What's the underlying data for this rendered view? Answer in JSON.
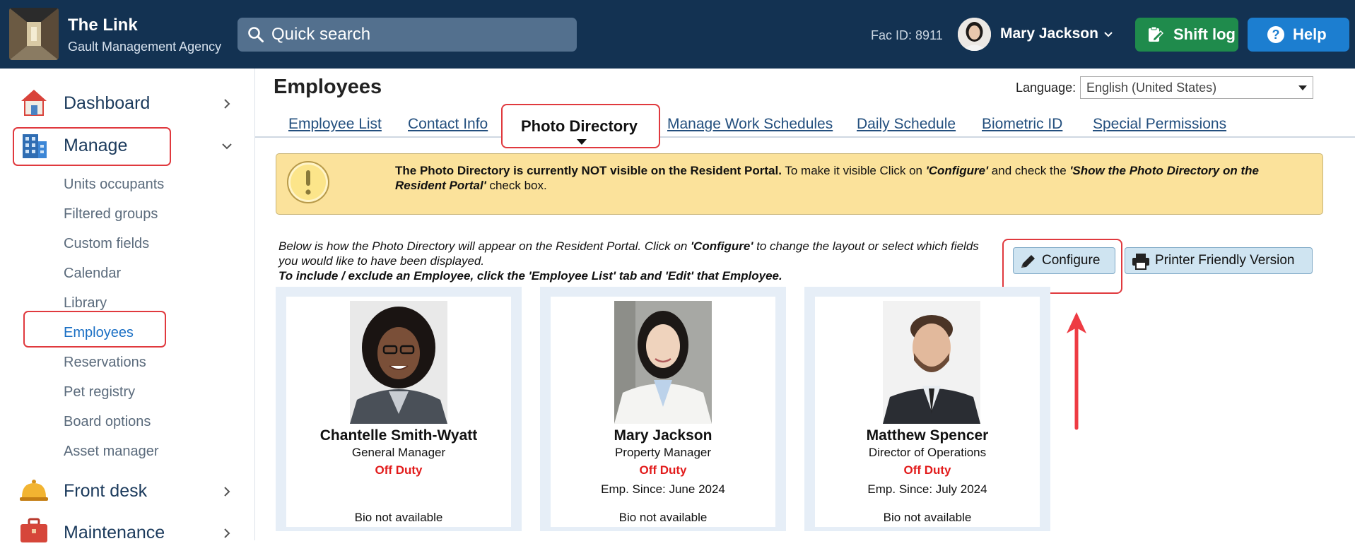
{
  "header": {
    "brand_name": "The Link",
    "brand_sub": "Gault Management Agency",
    "search_placeholder": "Quick search",
    "fac_id": "Fac ID: 8911",
    "user_name": "Mary Jackson",
    "shift_log": "Shift log",
    "help": "Help"
  },
  "sidebar": {
    "dashboard": "Dashboard",
    "manage": "Manage",
    "manage_items": [
      "Units occupants",
      "Filtered groups",
      "Custom fields",
      "Calendar",
      "Library",
      "Employees",
      "Reservations",
      "Pet registry",
      "Board options",
      "Asset manager"
    ],
    "front_desk": "Front desk",
    "maintenance": "Maintenance"
  },
  "main": {
    "title": "Employees",
    "language_label": "Language:",
    "language_value": "English (United States)",
    "tabs": [
      "Employee List",
      "Contact Info",
      "Photo Directory",
      "Manage Work Schedules",
      "Daily Schedule",
      "Biometric ID",
      "Special Permissions"
    ],
    "alert_bold": "The Photo Directory is currently NOT visible on the Resident Portal.",
    "alert_text1": " To make it visible Click on ",
    "alert_bi1": "'Configure'",
    "alert_text2": " and check the ",
    "alert_bi2": "'Show the Photo Directory on the Resident Portal'",
    "alert_text3": " check box.",
    "intro1": "Below is how the Photo Directory will appear on the Resident Portal. Click on ",
    "intro_configure": "'Configure'",
    "intro2": " to change the layout or select which fields you would like to have been displayed.",
    "intro_bold": "To include / exclude an Employee, click the 'Employee List' tab and 'Edit' that Employee.",
    "configure_label": "Configure",
    "print_label": "Printer Friendly Version"
  },
  "employees": [
    {
      "name": "Chantelle Smith-Wyatt",
      "role": "General Manager",
      "status": "Off Duty",
      "since": "",
      "bio": "Bio not available"
    },
    {
      "name": "Mary Jackson",
      "role": "Property Manager",
      "status": "Off Duty",
      "since": "Emp. Since: June 2024",
      "bio": "Bio not available"
    },
    {
      "name": "Matthew Spencer",
      "role": "Director of Operations",
      "status": "Off Duty",
      "since": "Emp. Since: July 2024",
      "bio": "Bio not available"
    }
  ],
  "colors": {
    "header_bg": "#133252",
    "accent_red": "#e0393e",
    "shift_green": "#1f8b4c",
    "help_blue": "#1c7ed0",
    "alert_bg": "#fbe29b"
  }
}
